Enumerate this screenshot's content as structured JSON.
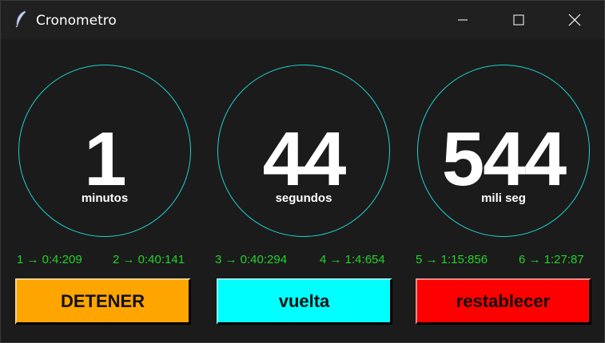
{
  "window": {
    "title": "Cronometro",
    "icons": {
      "app": "feather-icon",
      "minimize": "minimize-icon",
      "maximize": "maximize-icon",
      "close": "close-icon"
    }
  },
  "dials": [
    {
      "value": "1",
      "label": "minutos"
    },
    {
      "value": "44",
      "label": "segundos"
    },
    {
      "value": "544",
      "label": "mili seg"
    }
  ],
  "laps": [
    "1 → 0:4:209",
    "2 → 0:40:141",
    "3 → 0:40:294",
    "4 → 1:4:654",
    "5 → 1:15:856",
    "6 → 1:27:87"
  ],
  "buttons": {
    "stop": {
      "label": "DETENER",
      "color": "#ffa500"
    },
    "lap": {
      "label": "vuelta",
      "color": "#00ffff"
    },
    "reset": {
      "label": "restablecer",
      "color": "#ff0000"
    }
  },
  "colors": {
    "dial_border": "#1fd0cf",
    "lap_text": "#22d32a",
    "background": "#1b1b1b"
  }
}
